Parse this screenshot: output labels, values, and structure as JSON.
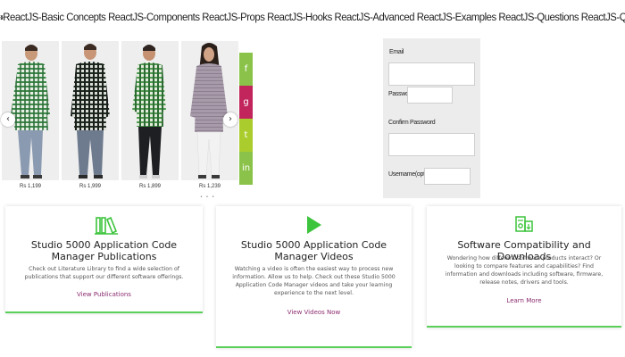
{
  "topnav": {
    "text": "ReactJS-Basic Concepts ReactJS-Components ReactJS-Props ReactJS-Hooks ReactJS-Advanced ReactJS-Examples ReactJS-Questions ReactJS-Quiz ReactJS-Tutorial Web Development Web Technol",
    "prev_arrow": "‹",
    "next_arrow": "›"
  },
  "carousel": {
    "prev_label": "‹",
    "next_label": "›",
    "dots": "• • •",
    "products": [
      {
        "price": "Rs 1,199"
      },
      {
        "price": "Rs 1,999"
      },
      {
        "price": "Rs 1,899"
      },
      {
        "price": "Rs 1,239"
      }
    ]
  },
  "social": [
    {
      "name": "facebook",
      "glyph": "f",
      "color": "#8bc34a"
    },
    {
      "name": "google",
      "glyph": "g",
      "color": "#c2255c"
    },
    {
      "name": "twitter",
      "glyph": "t",
      "color": "#aacd2d"
    },
    {
      "name": "linkedin",
      "glyph": "in",
      "color": "#8bc34a"
    }
  ],
  "form": {
    "email_label": "Email",
    "password_label": "Password",
    "confirm_label": "Confirm Password",
    "username_label": "Username(optional)",
    "email_value": "",
    "password_value": "",
    "confirm_value": "",
    "username_value": ""
  },
  "cards": [
    {
      "icon": "books-icon",
      "title": "Studio 5000 Application Code Manager Publications",
      "desc": "Check out Literature Library to find a wide selection of publications that support our different software offerings.",
      "link": "View Publications"
    },
    {
      "icon": "play-icon",
      "title": "Studio 5000 Application Code Manager Videos",
      "desc": "Watching a video is often the easiest way to process new information. Allow us to help. Check out these Studio 5000 Application Code Manager videos and take your learning experience to the next level.",
      "link": "View Videos Now"
    },
    {
      "icon": "download-icon",
      "title": "Software Compatibility and Downloads",
      "desc": "Wondering how different software products interact? Or looking to compare features and capabilities? Find information and downloads including software, firmware, release notes, drivers and tools.",
      "link": "Learn More"
    }
  ],
  "colors": {
    "accent_green": "#5ad05a",
    "icon_green": "#3cc43c",
    "link_purple": "#8b2c6f"
  }
}
